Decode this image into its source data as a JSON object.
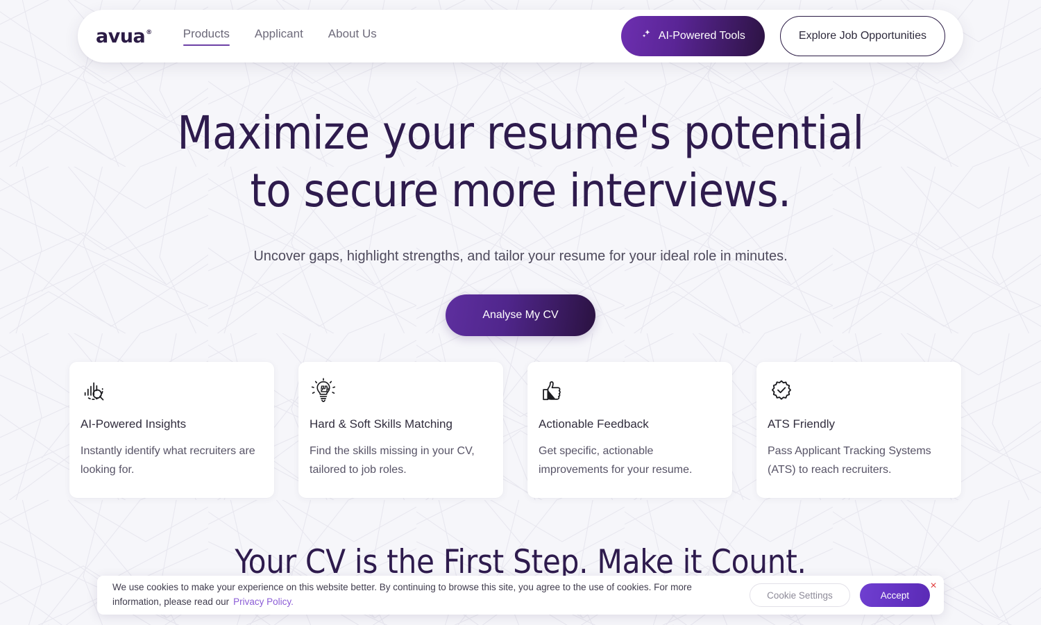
{
  "header": {
    "logo": "avua",
    "logo_mark": "®",
    "nav": [
      {
        "label": "Products",
        "active": true
      },
      {
        "label": "Applicant",
        "active": false
      },
      {
        "label": "About Us",
        "active": false
      }
    ],
    "ai_tools_button": "AI-Powered Tools",
    "explore_button": "Explore Job Opportunities",
    "accent_color": "#6c3fa5"
  },
  "hero": {
    "heading_line1": "Maximize your resume's potential",
    "heading_line2": "to secure more interviews.",
    "subheading": "Uncover gaps, highlight strengths, and tailor your resume for your ideal role in minutes.",
    "cta_label": "Analyse My CV",
    "heading_color": "#2e1b4d"
  },
  "features": [
    {
      "icon": "bar-chart-search-icon",
      "title": "AI-Powered Insights",
      "desc": "Instantly identify what recruiters are looking for."
    },
    {
      "icon": "lightbulb-puzzle-icon",
      "title": "Hard & Soft Skills Matching",
      "desc": "Find the skills missing in your CV, tailored to job roles."
    },
    {
      "icon": "thumbs-up-icon",
      "title": "Actionable Feedback",
      "desc": "Get specific, actionable improvements for your resume."
    },
    {
      "icon": "verified-badge-icon",
      "title": "ATS Friendly",
      "desc": "Pass Applicant Tracking Systems (ATS) to reach recruiters."
    }
  ],
  "section": {
    "heading": "Your CV is the First Step. Make it Count."
  },
  "cookie_banner": {
    "text": "We use cookies to make your experience on this website better. By continuing to browse this site, you agree to the use of cookies. For more information, please read our",
    "link_label": "Privacy Policy.",
    "settings_label": "Cookie Settings",
    "accept_label": "Accept",
    "close_label": "×",
    "close_color": "#e03b3b",
    "link_color": "#8b5cd6"
  }
}
